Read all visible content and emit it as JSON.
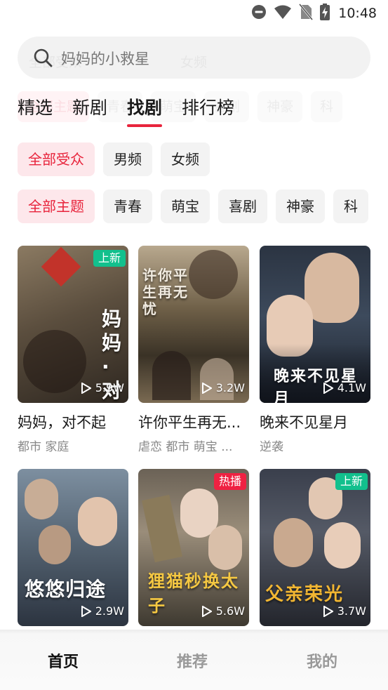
{
  "status_bar": {
    "time": "10:48"
  },
  "search": {
    "placeholder": "妈妈的小救星",
    "ghost_left": "全部受众",
    "ghost_right": "女频"
  },
  "tabs": {
    "items": [
      "精选",
      "新剧",
      "找剧",
      "排行榜"
    ],
    "active": "找剧",
    "ghost_chips": [
      "全部主题",
      "青春",
      "萌宝",
      "喜剧",
      "神豪",
      "科"
    ]
  },
  "audience_filters": [
    "全部受众",
    "男频",
    "女频"
  ],
  "theme_filters": [
    "全部主题",
    "青春",
    "萌宝",
    "喜剧",
    "神豪",
    "科"
  ],
  "dramas": [
    {
      "title": "妈妈，对不起",
      "tags": "都市 家庭",
      "plays": "5.9W",
      "badge": "上新",
      "badge_type": "new",
      "poster_text": "妈妈·对不起"
    },
    {
      "title": "许你平生再无...",
      "tags": "虐恋 都市 萌宝 ...",
      "plays": "3.2W",
      "badge": "",
      "badge_type": "",
      "poster_text": "许你平生再无忧"
    },
    {
      "title": "晚来不见星月",
      "tags": "逆袭",
      "plays": "4.1W",
      "badge": "",
      "badge_type": "",
      "poster_text": "晚来不见星月"
    },
    {
      "title": "",
      "tags": "",
      "plays": "2.9W",
      "badge": "",
      "badge_type": "",
      "poster_text": "悠悠归途"
    },
    {
      "title": "",
      "tags": "",
      "plays": "5.6W",
      "badge": "热播",
      "badge_type": "hot",
      "poster_text": "狸猫秒换太子"
    },
    {
      "title": "",
      "tags": "",
      "plays": "3.7W",
      "badge": "上新",
      "badge_type": "new",
      "poster_text": "父亲荣光"
    }
  ],
  "bottom_nav": {
    "items": [
      "首页",
      "推荐",
      "我的"
    ],
    "active": "首页"
  },
  "colors": {
    "accent": "#e8243c",
    "new_badge": "#12c08d",
    "hot_badge": "#ef2142"
  }
}
